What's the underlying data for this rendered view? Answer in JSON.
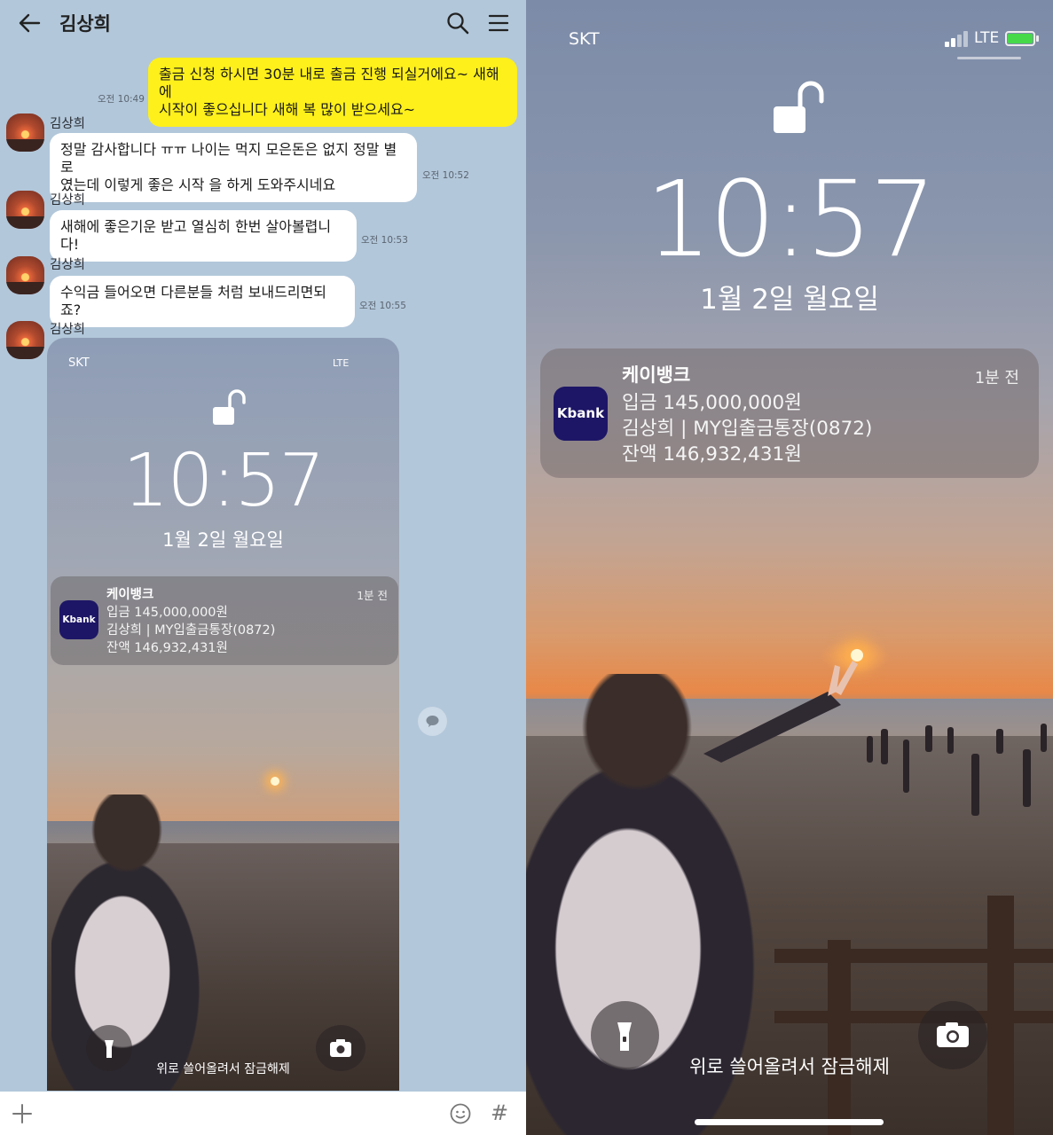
{
  "chat": {
    "header": {
      "title": "김상희"
    },
    "messages": [
      {
        "side": "me",
        "text_line1": "출금 신청 하시면 30분 내로 출금 진행 되실거에요~ 새해에",
        "text_line2": "시작이 좋으십니다 새해 복 많이 받으세요~",
        "time": "오전 10:49"
      },
      {
        "side": "you",
        "sender": "김상희",
        "text_line1": "정말 감사합니다 ㅠㅠ 나이는 먹지 모은돈은 없지 정말 별로",
        "text_line2": "였는데 이렇게 좋은 시작 을 하게 도와주시네요",
        "time": "오전 10:52"
      },
      {
        "side": "you",
        "sender": "김상희",
        "text_line1": "새해에 좋은기운 받고 열심히 한번 살아볼렵니다!",
        "time": "오전 10:53"
      },
      {
        "side": "you",
        "sender": "김상희",
        "text_line1": "수익금 들어오면 다른분들 처럼 보내드리면되죠?",
        "time": "오전 10:55"
      },
      {
        "side": "you",
        "sender": "김상희"
      }
    ],
    "input": {
      "plus_icon": "plus-icon",
      "emoji_icon": "emoji-icon",
      "hash": "#"
    }
  },
  "lockscreen": {
    "carrier": "SKT",
    "network": "LTE",
    "battery_color": "#46d94a",
    "time": "10:57",
    "date": "1월 2일 월요일",
    "notification": {
      "app": "케이뱅크",
      "app_icon_label": "Kbank",
      "app_icon_color": "#1d1666",
      "ago": "1분 전",
      "line1": "입금 145,000,000원",
      "line2": "김상희 | MY입출금통장(0872)",
      "line3": "잔액 146,932,431원"
    },
    "swipe_hint": "위로 쓸어올려서 잠금해제"
  }
}
